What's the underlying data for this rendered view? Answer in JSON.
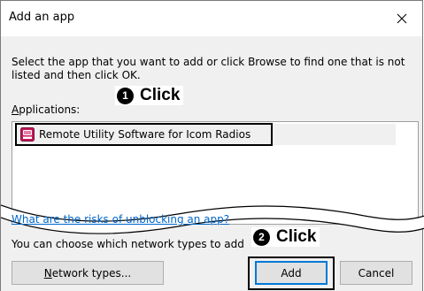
{
  "window": {
    "title": "Add an app"
  },
  "instructions": "Select the app that you want to add or click Browse to find one that is not listed and then click OK.",
  "applications": {
    "label_access": "A",
    "label_rest": "pplications:",
    "items": [
      {
        "label": "Remote Utility Software for Icom Radios",
        "icon": "app-icon"
      }
    ]
  },
  "callouts": {
    "step1": {
      "badge": "1",
      "text": "Click"
    },
    "step2": {
      "badge": "2",
      "text": "Click"
    }
  },
  "risk_link": "What are the risks of unblocking an app?",
  "network_text": "You can choose which network types to add",
  "buttons": {
    "network_types_access": "N",
    "network_types_rest": "etwork types...",
    "add": "Add",
    "cancel": "Cancel"
  },
  "colors": {
    "link": "#0066cc",
    "accent": "#0078d7",
    "dialog_bg": "#f0f0f0"
  }
}
